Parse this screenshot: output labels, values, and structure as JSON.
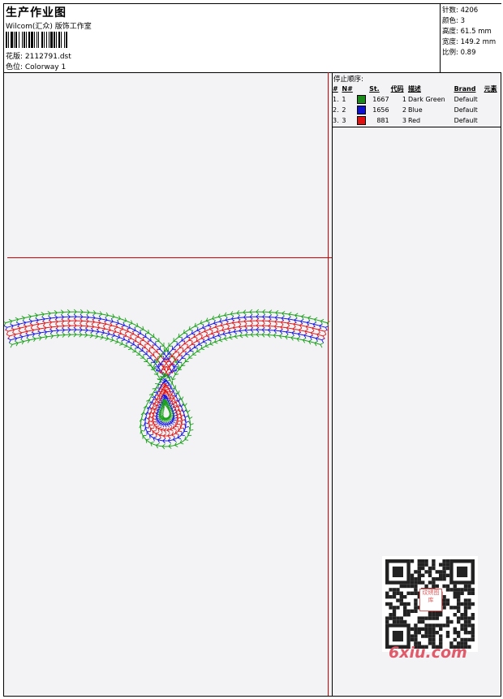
{
  "header": {
    "title": "生产作业图",
    "company": "Wilcom(汇众) 版饰工作室",
    "design_label": "花版: 2112791.dst",
    "colorway_label": "色位: Colorway 1"
  },
  "stats": {
    "stitches": "针数: 4206",
    "colors": "颜色: 3",
    "height": "高度: 61.5 mm",
    "width": "宽度: 149.2 mm",
    "scale": "比例: 0.89"
  },
  "color_table": {
    "title": "停止顺序:",
    "headers": [
      "#",
      "N#",
      "St.",
      "代码",
      "描述",
      "Brand",
      "元素"
    ],
    "rows": [
      {
        "seq": "1.",
        "n": "1",
        "color": "#1a8a1a",
        "st": "1667",
        "code": "1",
        "desc": "Dark Green",
        "brand": "Default"
      },
      {
        "seq": "2.",
        "n": "2",
        "color": "#1010d0",
        "st": "1656",
        "code": "2",
        "desc": "Blue",
        "brand": "Default"
      },
      {
        "seq": "3.",
        "n": "3",
        "color": "#e01010",
        "st": "881",
        "code": "3",
        "desc": "Red",
        "brand": "Default"
      }
    ]
  },
  "watermark": {
    "text": "6xiu.com",
    "qr_badge": "纹绣图库"
  },
  "colors": {
    "green": "#1aa01a",
    "blue": "#1a1ae0",
    "red": "#e01a1a",
    "guide": "#d10000"
  }
}
